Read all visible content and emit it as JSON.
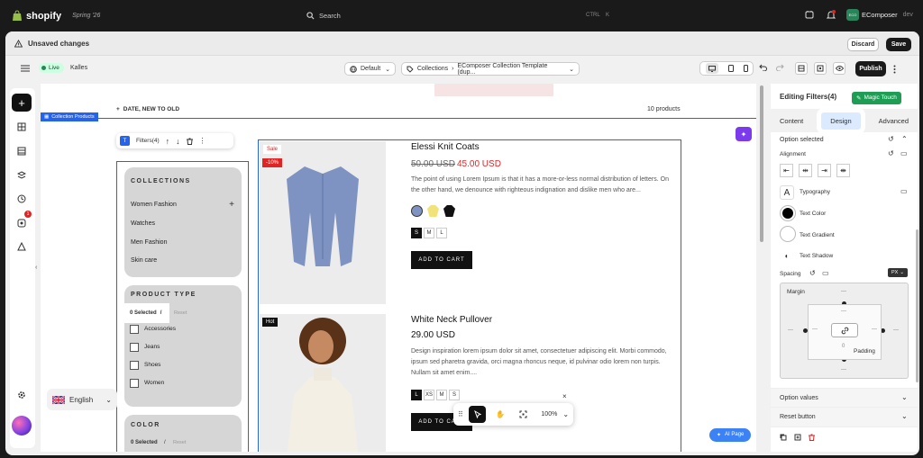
{
  "topbar": {
    "brand": "shopify",
    "store": "Spring '26",
    "search": "Search",
    "shortcut_ctrl": "CTRL",
    "shortcut_key": "K",
    "app_initials": "ECO",
    "app_name": "EComposer",
    "app_env": "dev"
  },
  "savebar": {
    "title": "Unsaved changes",
    "discard": "Discard",
    "save": "Save"
  },
  "toolbar": {
    "live": "Live",
    "theme": "Kalles",
    "template_select": "Default",
    "breadcrumb": "Collections",
    "template_name": "EComposer Collection Template (dup...",
    "publish": "Publish"
  },
  "sidebar": {
    "badge": "1"
  },
  "canvas": {
    "sort": "DATE, NEW TO OLD",
    "count": "10 products",
    "section_tag": "Collection Products",
    "filters_tag": "Filters(4)",
    "collections": {
      "title": "COLLECTIONS",
      "items": [
        "Women Fashion",
        "Watches",
        "Men Fashion",
        "Skin care"
      ]
    },
    "product_type": {
      "title": "PRODUCT TYPE",
      "selected": "0 Selected",
      "sep": "/",
      "reset": "Reset",
      "items": [
        "Accessories",
        "Jeans",
        "Shoes",
        "Women"
      ]
    },
    "color": {
      "title": "COLOR",
      "selected": "0 Selected",
      "sep": "/",
      "reset": "Reset"
    },
    "language": "English",
    "products": [
      {
        "badge1": "Sale",
        "badge2": "-10%",
        "title": "Elessi Knit Coats",
        "old_price": "50.00 USD",
        "price": "45.00 USD",
        "desc": "The point of using Lorem Ipsum is that it has a more-or-less normal distribution of letters. On the other hand, we denounce with righteous indignation and dislike men who are...",
        "sizes": [
          "S",
          "M",
          "L"
        ],
        "cta": "ADD TO CART"
      },
      {
        "badge1": "Hot",
        "title": "White Neck Pullover",
        "price": "29.00 USD",
        "desc": "Design inspiration lorem ipsum dolor sit amet, consectetuer adipiscing elit. Morbi commodo, ipsum sed pharetra gravida, orci magna rhoncus neque, id pulvinar odio lorem non turpis. Nullam sit amet enim....",
        "sizes": [
          "L",
          "XS",
          "M",
          "S"
        ],
        "cta": "ADD TO CART"
      }
    ],
    "zoom": "100%",
    "ai_page": "AI Page"
  },
  "panel": {
    "title": "Editing Filters(4)",
    "magic": "Magic Touch",
    "tabs": [
      "Content",
      "Design",
      "Advanced"
    ],
    "active_tab": "Design",
    "option_selected": "Option selected",
    "alignment": "Alignment",
    "typography": "Typography",
    "text_color": "Text Color",
    "text_gradient": "Text Gradient",
    "text_shadow": "Text Shadow",
    "spacing": "Spacing",
    "unit": "PX",
    "margin": "Margin",
    "margin_top": "—",
    "margin_bottom": "—",
    "margin_left": "—",
    "margin_right": "—",
    "padding_top": "—",
    "padding_bottom": "0",
    "padding_left": "—",
    "padding_right": "—",
    "padding": "Padding",
    "option_values": "Option values",
    "reset_button": "Reset button"
  },
  "colors": {
    "accent": "#2563eb",
    "live": "#29845a",
    "sale": "#e02424",
    "magic": "#1f9d55"
  }
}
